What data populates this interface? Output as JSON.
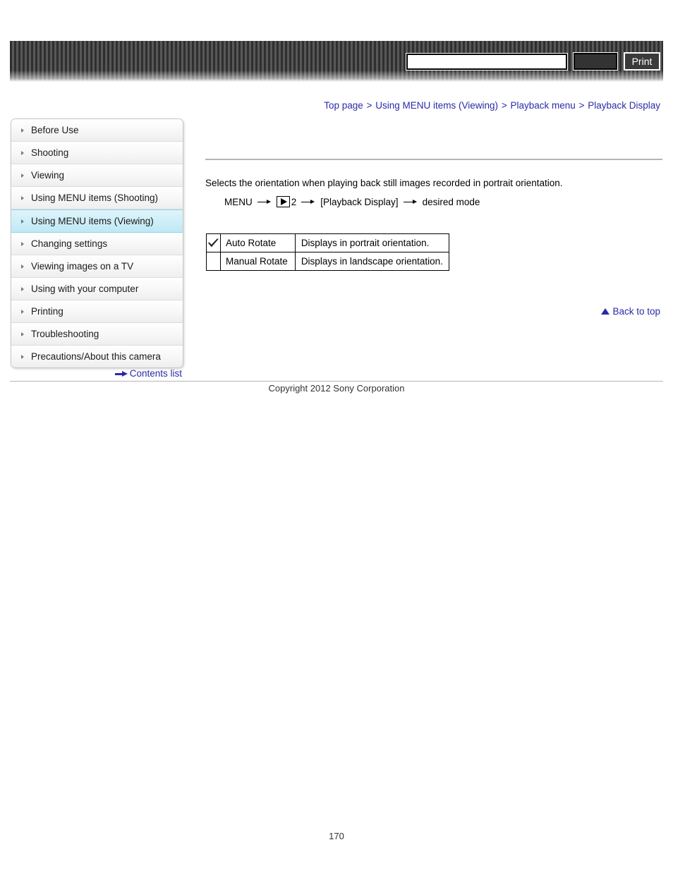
{
  "header": {
    "search": {
      "value": "",
      "placeholder": ""
    },
    "search_button_label": "",
    "print_button_label": "Print"
  },
  "breadcrumb": {
    "separator": ">",
    "items": [
      "Top page",
      "Using MENU items (Viewing)",
      "Playback menu",
      "Playback Display"
    ]
  },
  "sidebar": {
    "items": [
      {
        "label": "Before Use",
        "active": false
      },
      {
        "label": "Shooting",
        "active": false
      },
      {
        "label": "Viewing",
        "active": false
      },
      {
        "label": "Using MENU items (Shooting)",
        "active": false
      },
      {
        "label": "Using MENU items (Viewing)",
        "active": true
      },
      {
        "label": "Changing settings",
        "active": false
      },
      {
        "label": "Viewing images on a TV",
        "active": false
      },
      {
        "label": "Using with your computer",
        "active": false
      },
      {
        "label": "Printing",
        "active": false
      },
      {
        "label": "Troubleshooting",
        "active": false
      },
      {
        "label": "Precautions/About this camera",
        "active": false
      }
    ],
    "contents_list_label": "Contents list"
  },
  "main": {
    "intro": "Selects the orientation when playing back still images recorded in portrait orientation.",
    "menu_path": {
      "start": "MENU",
      "number": "2",
      "bracket_item": "[Playback Display]",
      "end": "desired mode"
    },
    "options_table": {
      "rows": [
        {
          "marked": true,
          "name": "Auto Rotate",
          "description": "Displays in portrait orientation."
        },
        {
          "marked": false,
          "name": "Manual Rotate",
          "description": "Displays in landscape orientation."
        }
      ]
    },
    "back_to_top_label": "Back to top"
  },
  "footer": {
    "copyright": "Copyright 2012 Sony Corporation",
    "page_number": "170"
  },
  "colors": {
    "link": "#2a2aa8",
    "active_nav": "#cfeef8",
    "rule": "#b5b5b5"
  }
}
